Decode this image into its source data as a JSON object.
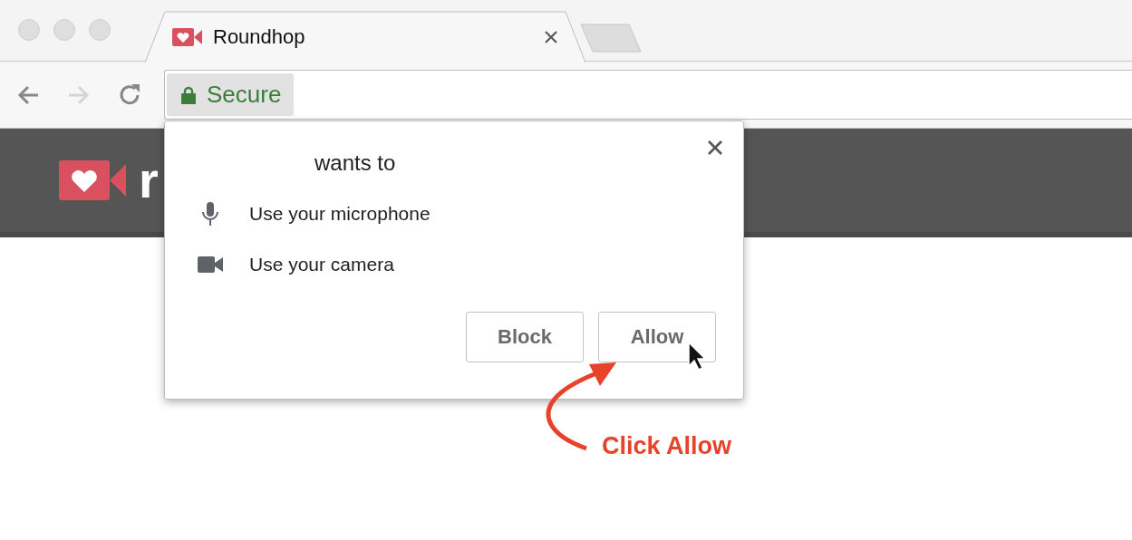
{
  "browser": {
    "tab": {
      "title": "Roundhop"
    },
    "nav": [
      {
        "kind": "back",
        "disabled": false
      },
      {
        "kind": "forward",
        "disabled": true
      },
      {
        "kind": "reload",
        "disabled": false
      }
    ],
    "address_bar": {
      "security_label": "Secure"
    }
  },
  "page": {
    "logo_text": "r"
  },
  "permission_dialog": {
    "heading": "wants to",
    "permissions": [
      {
        "kind": "microphone",
        "label": "Use your microphone"
      },
      {
        "kind": "camera",
        "label": "Use your camera"
      }
    ],
    "buttons": [
      "Block",
      "Allow"
    ]
  },
  "annotation": {
    "text": "Click Allow"
  }
}
